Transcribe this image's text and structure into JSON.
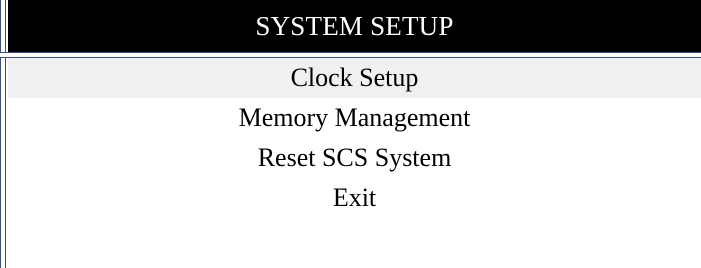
{
  "header": {
    "title": "SYSTEM SETUP"
  },
  "menu": {
    "selected_index": 0,
    "items": [
      {
        "label": "Clock Setup"
      },
      {
        "label": "Memory Management"
      },
      {
        "label": "Reset SCS System"
      },
      {
        "label": "Exit"
      }
    ]
  },
  "colors": {
    "title_background": "#000000",
    "title_text": "#ffffff",
    "selected_row": "#f0f0f0",
    "border": "#3a4f86"
  }
}
